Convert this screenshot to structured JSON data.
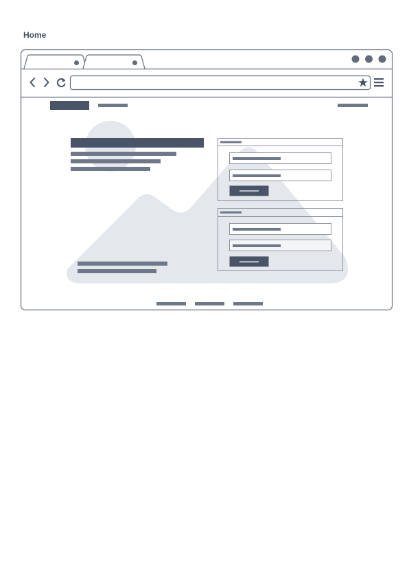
{
  "page": {
    "title": "Home"
  },
  "colors": {
    "outline": "#616b7a",
    "dark": "#4a5469",
    "medium": "#6e788a",
    "light_fill": "#e4e7eb",
    "field_border": "#8c94a0"
  },
  "browser": {
    "tabs": [
      {
        "state": "active",
        "close_icon": "dot-icon"
      },
      {
        "state": "inactive",
        "close_icon": "dot-icon"
      }
    ],
    "window_controls": [
      "circle-icon",
      "circle-icon",
      "circle-icon"
    ],
    "toolbar_icons": [
      "back-arrow-icon",
      "forward-arrow-icon",
      "reload-icon",
      "star-icon",
      "hamburger-menu-icon"
    ]
  },
  "wireframe": {
    "background_image_icon": "image-placeholder-icon",
    "forms": [
      {
        "fields": 2,
        "button": "submit-button-placeholder"
      },
      {
        "fields": 2,
        "button": "submit-button-placeholder"
      }
    ]
  }
}
